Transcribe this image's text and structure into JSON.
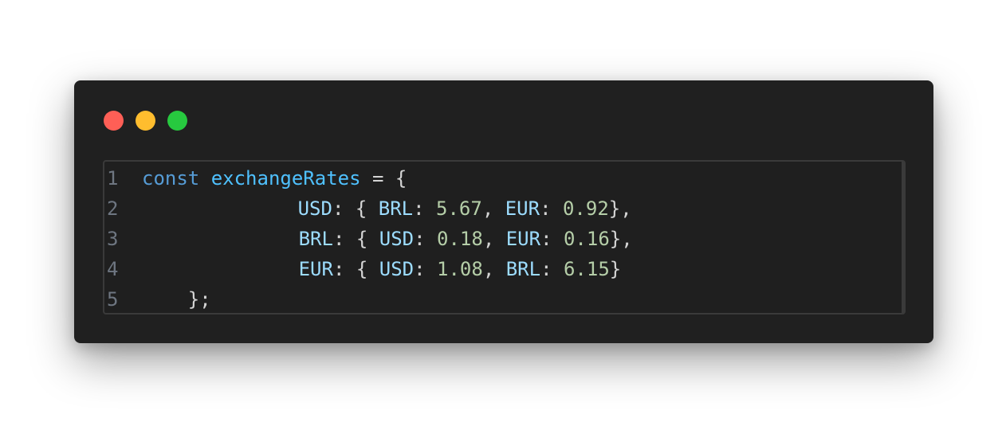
{
  "window": {
    "controls": [
      {
        "name": "close",
        "color": "#ff5f56"
      },
      {
        "name": "minimize",
        "color": "#ffbd2e"
      },
      {
        "name": "maximize",
        "color": "#27c93f"
      }
    ]
  },
  "theme": {
    "background": "#202020",
    "editor_background": "#1f1f1f",
    "line_number": "#6e7681",
    "keyword": "#569cd6",
    "identifier": "#4fc1ff",
    "property": "#9cdcfe",
    "number": "#b5cea8",
    "punctuation": "#d4d4d4"
  },
  "code": {
    "lines": [
      {
        "number": "1",
        "tokens": [
          {
            "t": "const",
            "k": "keyword"
          },
          {
            "t": " ",
            "k": "space"
          },
          {
            "t": "exchangeRates",
            "k": "ident"
          },
          {
            "t": " = {",
            "k": "punct"
          }
        ]
      },
      {
        "number": "2",
        "tokens": [
          {
            "t": "        ",
            "k": "space"
          },
          {
            "t": "USD",
            "k": "key"
          },
          {
            "t": ": { ",
            "k": "punct"
          },
          {
            "t": "BRL",
            "k": "key"
          },
          {
            "t": ": ",
            "k": "punct"
          },
          {
            "t": "5.67",
            "k": "num"
          },
          {
            "t": ", ",
            "k": "punct"
          },
          {
            "t": "EUR",
            "k": "key"
          },
          {
            "t": ": ",
            "k": "punct"
          },
          {
            "t": "0.92",
            "k": "num"
          },
          {
            "t": "},",
            "k": "punct"
          }
        ]
      },
      {
        "number": "3",
        "tokens": [
          {
            "t": "        ",
            "k": "space"
          },
          {
            "t": "BRL",
            "k": "key"
          },
          {
            "t": ": { ",
            "k": "punct"
          },
          {
            "t": "USD",
            "k": "key"
          },
          {
            "t": ": ",
            "k": "punct"
          },
          {
            "t": "0.18",
            "k": "num"
          },
          {
            "t": ", ",
            "k": "punct"
          },
          {
            "t": "EUR",
            "k": "key"
          },
          {
            "t": ": ",
            "k": "punct"
          },
          {
            "t": "0.16",
            "k": "num"
          },
          {
            "t": "},",
            "k": "punct"
          }
        ]
      },
      {
        "number": "4",
        "tokens": [
          {
            "t": "        ",
            "k": "space"
          },
          {
            "t": "EUR",
            "k": "key"
          },
          {
            "t": ": { ",
            "k": "punct"
          },
          {
            "t": "USD",
            "k": "key"
          },
          {
            "t": ": ",
            "k": "punct"
          },
          {
            "t": "1.08",
            "k": "num"
          },
          {
            "t": ", ",
            "k": "punct"
          },
          {
            "t": "BRL",
            "k": "key"
          },
          {
            "t": ": ",
            "k": "punct"
          },
          {
            "t": "6.15",
            "k": "num"
          },
          {
            "t": "}",
            "k": "punct"
          }
        ]
      },
      {
        "number": "5",
        "tokens": [
          {
            "t": "    ",
            "k": "space"
          },
          {
            "t": "};",
            "k": "punct"
          }
        ]
      }
    ]
  }
}
